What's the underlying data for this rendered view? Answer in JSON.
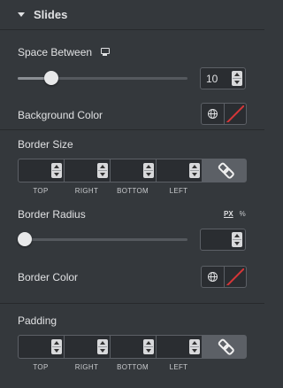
{
  "section": {
    "title": "Slides"
  },
  "space_between": {
    "label": "Space Between",
    "device_icon": "monitor-icon",
    "value": "10",
    "slider_fraction": 0.2
  },
  "background_color": {
    "label": "Background Color",
    "global_icon": "globe-icon",
    "swatch": "none"
  },
  "border_size": {
    "label": "Border Size",
    "fields": [
      {
        "label": "TOP",
        "value": ""
      },
      {
        "label": "RIGHT",
        "value": ""
      },
      {
        "label": "BOTTOM",
        "value": ""
      },
      {
        "label": "LEFT",
        "value": ""
      }
    ],
    "link_icon": "link-icon"
  },
  "border_radius": {
    "label": "Border Radius",
    "unit_px": "PX",
    "unit_pct": "%",
    "value": "",
    "slider_fraction": 0
  },
  "border_color": {
    "label": "Border Color",
    "global_icon": "globe-icon",
    "swatch": "none"
  },
  "padding": {
    "label": "Padding",
    "fields": [
      {
        "label": "TOP",
        "value": ""
      },
      {
        "label": "RIGHT",
        "value": ""
      },
      {
        "label": "BOTTOM",
        "value": ""
      },
      {
        "label": "LEFT",
        "value": ""
      }
    ],
    "link_icon": "link-icon"
  },
  "colors": {
    "panel": "#34383c",
    "input_bg": "#2a2d31",
    "border": "#5c6066",
    "clear_swatch": "#d63638"
  }
}
